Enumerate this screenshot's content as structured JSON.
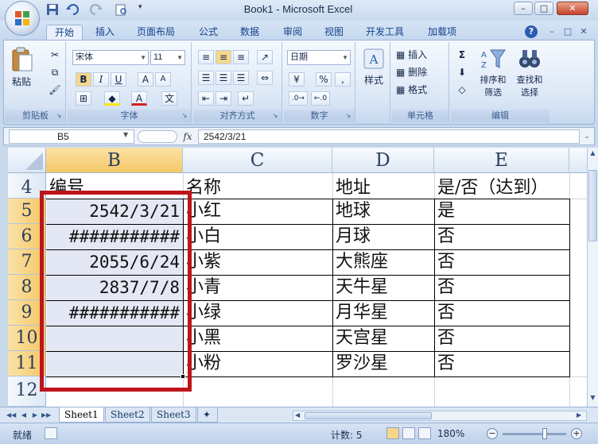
{
  "window": {
    "title": "Book1 - Microsoft Excel",
    "minimize": "–",
    "maximize": "□",
    "close": "✕"
  },
  "tabs": [
    {
      "label": "开始",
      "active": true
    },
    {
      "label": "插入"
    },
    {
      "label": "页面布局"
    },
    {
      "label": "公式"
    },
    {
      "label": "数据"
    },
    {
      "label": "审阅"
    },
    {
      "label": "视图"
    },
    {
      "label": "开发工具"
    },
    {
      "label": "加载项"
    }
  ],
  "ribbon": {
    "clipboard": {
      "label": "剪贴板",
      "paste": "粘贴"
    },
    "font": {
      "label": "字体",
      "family": "宋体",
      "size": "11",
      "bold": "B",
      "italic": "I",
      "underline": "U",
      "grow": "A",
      "shrink": "A",
      "font_color": "A",
      "phonetic": "文"
    },
    "alignment": {
      "label": "对齐方式"
    },
    "number": {
      "label": "数字",
      "format": "日期",
      "percent": "%",
      "comma": ","
    },
    "styles": {
      "label": "样式"
    },
    "cells": {
      "label": "单元格",
      "insert": "插入",
      "delete": "删除",
      "format": "格式"
    },
    "editing": {
      "label": "编辑",
      "sort": "排序和",
      "sort2": "筛选",
      "find": "查找和",
      "find2": "选择",
      "sum": "Σ"
    }
  },
  "formula_bar": {
    "name_box": "B5",
    "fx": "fx",
    "value": "2542/3/21"
  },
  "columns": [
    "B",
    "C",
    "D",
    "E"
  ],
  "rows": [
    {
      "num": "4",
      "b": "编号",
      "c": "名称",
      "d": "地址",
      "e": "是/否（达到）"
    },
    {
      "num": "5",
      "b": "2542/3/21",
      "c": "小红",
      "d": "地球",
      "e": "是"
    },
    {
      "num": "6",
      "b": "###########",
      "c": "小白",
      "d": "月球",
      "e": "否"
    },
    {
      "num": "7",
      "b": "2055/6/24",
      "c": "小紫",
      "d": "大熊座",
      "e": "否"
    },
    {
      "num": "8",
      "b": "2837/7/8",
      "c": "小青",
      "d": "天牛星",
      "e": "否"
    },
    {
      "num": "9",
      "b": "###########",
      "c": "小绿",
      "d": "月华星",
      "e": "否"
    },
    {
      "num": "10",
      "b": "",
      "c": "小黑",
      "d": "天宫星",
      "e": "否"
    },
    {
      "num": "11",
      "b": "",
      "c": "小粉",
      "d": "罗沙星",
      "e": "否"
    },
    {
      "num": "12",
      "b": "",
      "c": "",
      "d": "",
      "e": ""
    }
  ],
  "sheets": [
    "Sheet1",
    "Sheet2",
    "Sheet3"
  ],
  "status": {
    "ready": "就绪",
    "count": "计数: 5",
    "zoom": "180%"
  },
  "colors": {
    "accent": "#15428b",
    "highlight": "#c0131b",
    "selection": "#f4c766"
  }
}
